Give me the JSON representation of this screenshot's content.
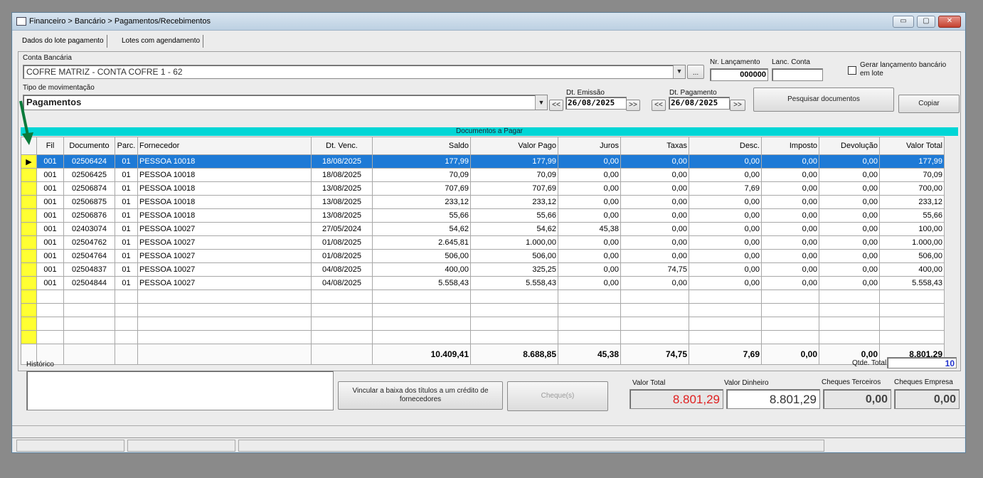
{
  "window": {
    "title": "Financeiro > Bancário > Pagamentos/Recebimentos",
    "minimize": "▭",
    "maximize": "▢",
    "close": "✕"
  },
  "tabs": [
    {
      "label": "Dados do lote pagamento"
    },
    {
      "label": "Lotes com agendamento"
    }
  ],
  "form": {
    "conta_label": "Conta Bancária",
    "conta_value": "COFRE MATRIZ - CONTA COFRE 1 - 62",
    "ellipsis": "...",
    "nr_lanc_label": "Nr. Lançamento",
    "nr_lanc_value": "000000",
    "lanc_conta_label": "Lanc. Conta",
    "lanc_conta_value": "",
    "gerar_label": "Gerar lançamento bancário em lote",
    "tipo_label": "Tipo de movimentação",
    "tipo_value": "Pagamentos",
    "dt_emissao_label": "Dt. Emissão",
    "dt_emissao_value": "26/08/2025",
    "dt_pagamento_label": "Dt. Pagamento",
    "dt_pagamento_value": "26/08/2025",
    "prev": "<<",
    "next": ">>",
    "pesquisar": "Pesquisar documentos",
    "copiar": "Copiar"
  },
  "grid": {
    "caption": "Documentos a Pagar",
    "columns": [
      "Fil",
      "Documento",
      "Parc.",
      "Fornecedor",
      "Dt. Venc.",
      "Saldo",
      "Valor Pago",
      "Juros",
      "Taxas",
      "Desc.",
      "Imposto",
      "Devolução",
      "Valor Total"
    ],
    "rows": [
      [
        "001",
        "02506424",
        "01",
        "PESSOA 10018",
        "18/08/2025",
        "177,99",
        "177,99",
        "0,00",
        "0,00",
        "0,00",
        "0,00",
        "0,00",
        "177,99"
      ],
      [
        "001",
        "02506425",
        "01",
        "PESSOA 10018",
        "18/08/2025",
        "70,09",
        "70,09",
        "0,00",
        "0,00",
        "0,00",
        "0,00",
        "0,00",
        "70,09"
      ],
      [
        "001",
        "02506874",
        "01",
        "PESSOA 10018",
        "13/08/2025",
        "707,69",
        "707,69",
        "0,00",
        "0,00",
        "7,69",
        "0,00",
        "0,00",
        "700,00"
      ],
      [
        "001",
        "02506875",
        "01",
        "PESSOA 10018",
        "13/08/2025",
        "233,12",
        "233,12",
        "0,00",
        "0,00",
        "0,00",
        "0,00",
        "0,00",
        "233,12"
      ],
      [
        "001",
        "02506876",
        "01",
        "PESSOA 10018",
        "13/08/2025",
        "55,66",
        "55,66",
        "0,00",
        "0,00",
        "0,00",
        "0,00",
        "0,00",
        "55,66"
      ],
      [
        "001",
        "02403074",
        "01",
        "PESSOA 10027",
        "27/05/2024",
        "54,62",
        "54,62",
        "45,38",
        "0,00",
        "0,00",
        "0,00",
        "0,00",
        "100,00"
      ],
      [
        "001",
        "02504762",
        "01",
        "PESSOA 10027",
        "01/08/2025",
        "2.645,81",
        "1.000,00",
        "0,00",
        "0,00",
        "0,00",
        "0,00",
        "0,00",
        "1.000,00"
      ],
      [
        "001",
        "02504764",
        "01",
        "PESSOA 10027",
        "01/08/2025",
        "506,00",
        "506,00",
        "0,00",
        "0,00",
        "0,00",
        "0,00",
        "0,00",
        "506,00"
      ],
      [
        "001",
        "02504837",
        "01",
        "PESSOA 10027",
        "04/08/2025",
        "400,00",
        "325,25",
        "0,00",
        "74,75",
        "0,00",
        "0,00",
        "0,00",
        "400,00"
      ],
      [
        "001",
        "02504844",
        "01",
        "PESSOA 10027",
        "04/08/2025",
        "5.558,43",
        "5.558,43",
        "0,00",
        "0,00",
        "0,00",
        "0,00",
        "0,00",
        "5.558,43"
      ]
    ],
    "totals": [
      "10.409,41",
      "8.688,85",
      "45,38",
      "74,75",
      "7,69",
      "0,00",
      "0,00",
      "8.801,29"
    ],
    "row_indicator": "▶"
  },
  "footer": {
    "historico_label": "Histórico",
    "vincular": "Vincular a baixa dos títulos a um crédito de fornecedores",
    "cheques": "Cheque(s)",
    "qtde_label": "Qtde. Total",
    "qtde_value": "10",
    "valor_total_label": "Valor Total",
    "valor_total_value": "8.801,29",
    "valor_dinheiro_label": "Valor Dinheiro",
    "valor_dinheiro_value": "8.801,29",
    "cheques_terceiros_label": "Cheques Terceiros",
    "cheques_terceiros_value": "0,00",
    "cheques_empresa_label": "Cheques Empresa",
    "cheques_empresa_value": "0,00"
  },
  "colors": {
    "grid_caption": "#00d6d6",
    "selected_row": "#1e7ad6",
    "row_indicator": "#ffff33",
    "valor_total_text": "#e02020",
    "qtde_text": "#2233cc",
    "arrow": "#0a7a3a"
  }
}
